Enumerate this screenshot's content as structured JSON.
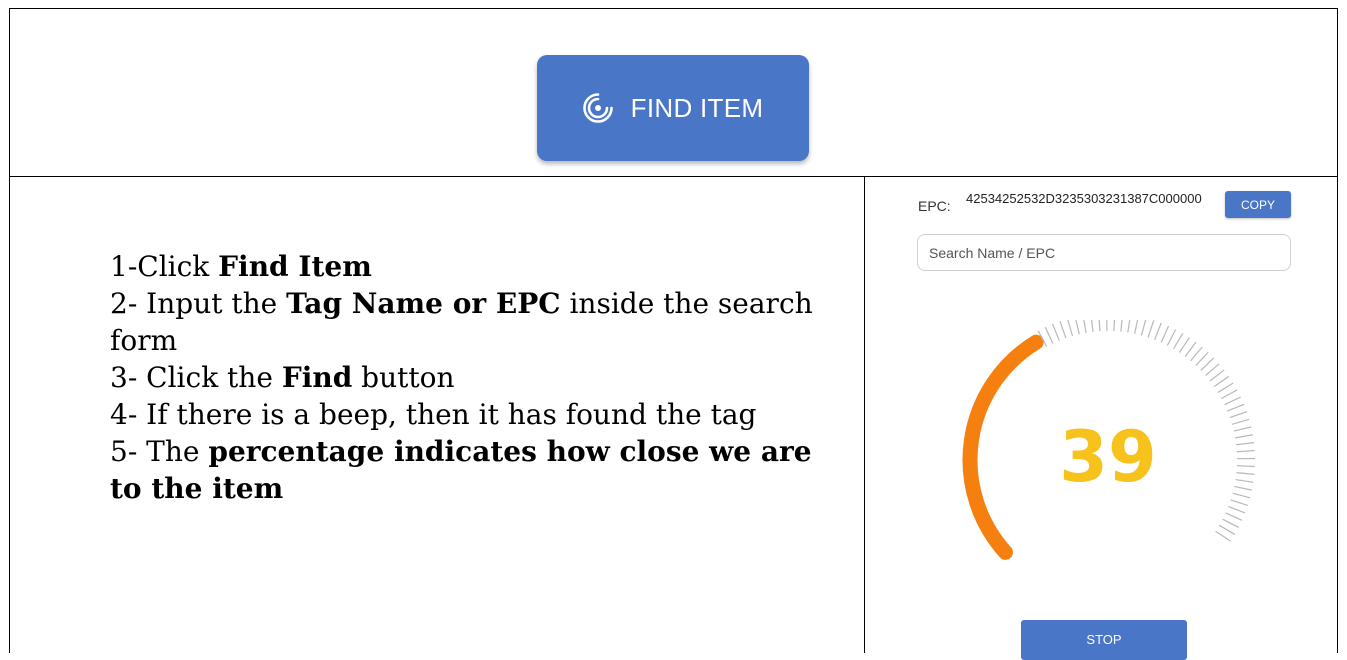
{
  "find_button": {
    "label": "FIND ITEM",
    "icon": "radar-icon",
    "color": "#4a76c7"
  },
  "instructions": [
    {
      "parts": [
        {
          "text": "1-Click ",
          "bold": false
        },
        {
          "text": "Find Item",
          "bold": true
        }
      ]
    },
    {
      "parts": [
        {
          "text": "2- Input the ",
          "bold": false
        },
        {
          "text": "Tag Name or EPC",
          "bold": true
        },
        {
          "text": " inside the search form",
          "bold": false
        }
      ]
    },
    {
      "parts": [
        {
          "text": "3- Click the ",
          "bold": false
        },
        {
          "text": "Find",
          "bold": true
        },
        {
          "text": " button",
          "bold": false
        }
      ]
    },
    {
      "parts": [
        {
          "text": "4- If there is a beep, then it has found the tag",
          "bold": false
        }
      ]
    },
    {
      "parts": [
        {
          "text": "5- The ",
          "bold": false
        },
        {
          "text": "percentage indicates how close we are to the item",
          "bold": true
        }
      ]
    }
  ],
  "panel": {
    "epc_label": "EPC:",
    "epc_value": "42534252532D3235303231387C000000",
    "copy_label": "COPY",
    "search_placeholder": "Search Name / EPC",
    "gauge_value": 39,
    "gauge_value_text": "39",
    "gauge_active_color": "#f5800f",
    "gauge_value_color": "#f7c21c",
    "stop_label": "STOP"
  }
}
